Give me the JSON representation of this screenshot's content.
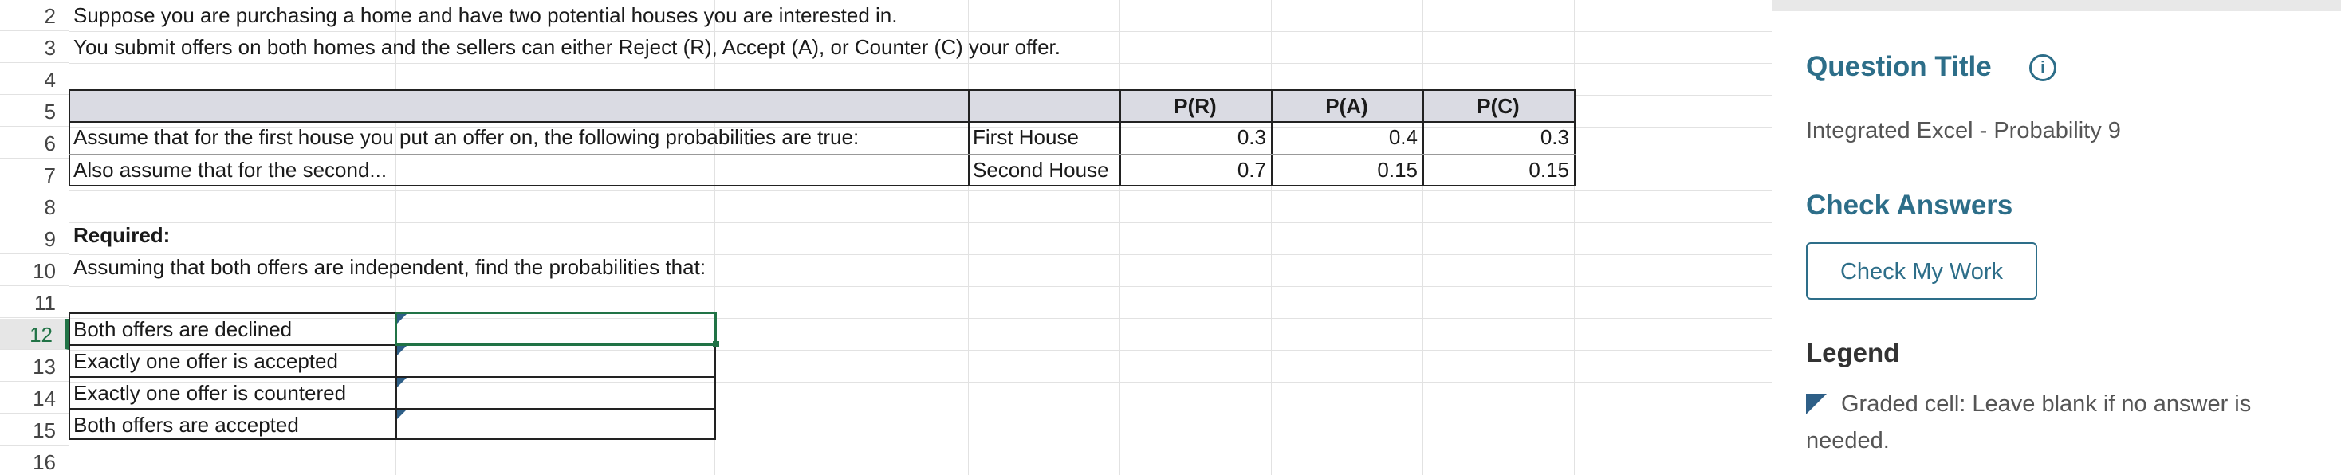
{
  "sheet": {
    "rows": [
      {
        "num": "2",
        "text": "Suppose you are purchasing a home and have two potential houses you are interested in."
      },
      {
        "num": "3",
        "text": "You submit offers on both homes and the sellers can either Reject (R), Accept (A), or Counter (C) your offer."
      },
      {
        "num": "4",
        "text": ""
      },
      {
        "num": "5",
        "text": ""
      },
      {
        "num": "6",
        "text": "Assume that for the first house you put an offer on, the following probabilities are true:"
      },
      {
        "num": "7",
        "text": "Also assume that for the second..."
      },
      {
        "num": "8",
        "text": ""
      },
      {
        "num": "9",
        "text": "Required:"
      },
      {
        "num": "10",
        "text": "Assuming that both offers are independent, find the probabilities that:"
      },
      {
        "num": "11",
        "text": ""
      },
      {
        "num": "12",
        "text": "Both offers are declined"
      },
      {
        "num": "13",
        "text": "Exactly one offer is accepted"
      },
      {
        "num": "14",
        "text": "Exactly one offer is countered"
      },
      {
        "num": "15",
        "text": "Both offers are accepted"
      },
      {
        "num": "16",
        "text": ""
      }
    ],
    "prob_table": {
      "headers": [
        "P(R)",
        "P(A)",
        "P(C)"
      ],
      "rows": [
        {
          "label": "First House",
          "values": [
            "0.3",
            "0.4",
            "0.3"
          ]
        },
        {
          "label": "Second House",
          "values": [
            "0.7",
            "0.15",
            "0.15"
          ]
        }
      ]
    },
    "answers": [
      "",
      "",
      "",
      ""
    ]
  },
  "panel": {
    "question_title_heading": "Question Title",
    "question_title": "Integrated Excel - Probability 9",
    "check_answers_heading": "Check Answers",
    "check_button": "Check My Work",
    "legend_heading": "Legend",
    "legend_text": "Graded cell: Leave blank if no answer is needed."
  },
  "colors": {
    "accent": "#2d6e89",
    "selection": "#217346",
    "table_header_fill": "#dadbe3",
    "graded_marker": "#2e5f87"
  },
  "icons": {
    "info": "accessibility-info-icon",
    "graded": "graded-cell-marker-icon"
  }
}
